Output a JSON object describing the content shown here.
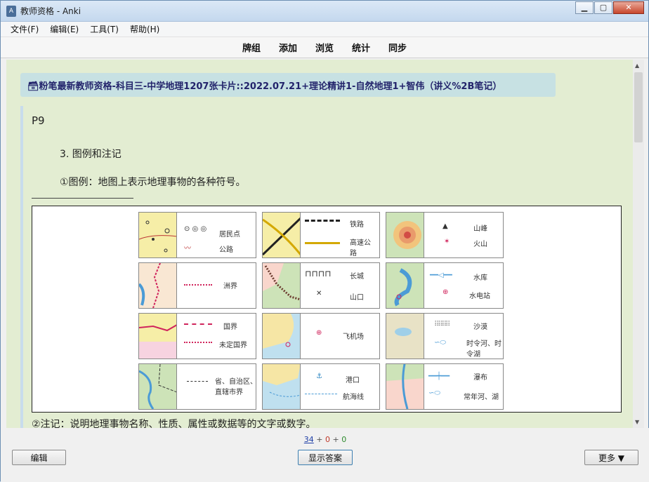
{
  "window": {
    "title": "教师资格 - Anki",
    "controls": [
      "minimize",
      "maximize",
      "close"
    ]
  },
  "menu": [
    "文件(F)",
    "编辑(E)",
    "工具(T)",
    "帮助(H)"
  ],
  "toolbar": [
    "牌组",
    "添加",
    "浏览",
    "统计",
    "同步"
  ],
  "card": {
    "deck_path": "🗃粉笔最新教师资格-科目三-中学地理1207张卡片::2022.07.21+理论精讲1-自然地理1+智伟（讲义%2B笔记）",
    "page": "P9",
    "heading": "3. 图例和注记",
    "legend_def": "①图例：地图上表示地理事物的各种符号。",
    "note_def": "②注记：说明地理事物名称、性质、属性或数据等的文字或数字。"
  },
  "legend_cells": [
    {
      "label1": "居民点",
      "label2": "公路"
    },
    {
      "label1": "铁路",
      "label2": "高速公路"
    },
    {
      "label1": "山峰",
      "label2": "火山"
    },
    {
      "label1": "洲界",
      "label2": ""
    },
    {
      "label1": "长城",
      "label2": "山口"
    },
    {
      "label1": "水库",
      "label2": "水电站"
    },
    {
      "label1": "国界",
      "label2": "未定国界"
    },
    {
      "label1": "飞机场",
      "label2": ""
    },
    {
      "label1": "沙漠",
      "label2": "时令河、时令湖"
    },
    {
      "label1": "省、自治区、直辖市界",
      "label2": ""
    },
    {
      "label1": "港口",
      "label2": "航海线"
    },
    {
      "label1": "瀑布",
      "label2": "常年河、湖"
    }
  ],
  "bottom": {
    "count_new": "34",
    "count_learn": "0",
    "count_review": "0",
    "edit_label": "编辑",
    "show_answer_label": "显示答案",
    "more_label": "更多 ▼"
  }
}
